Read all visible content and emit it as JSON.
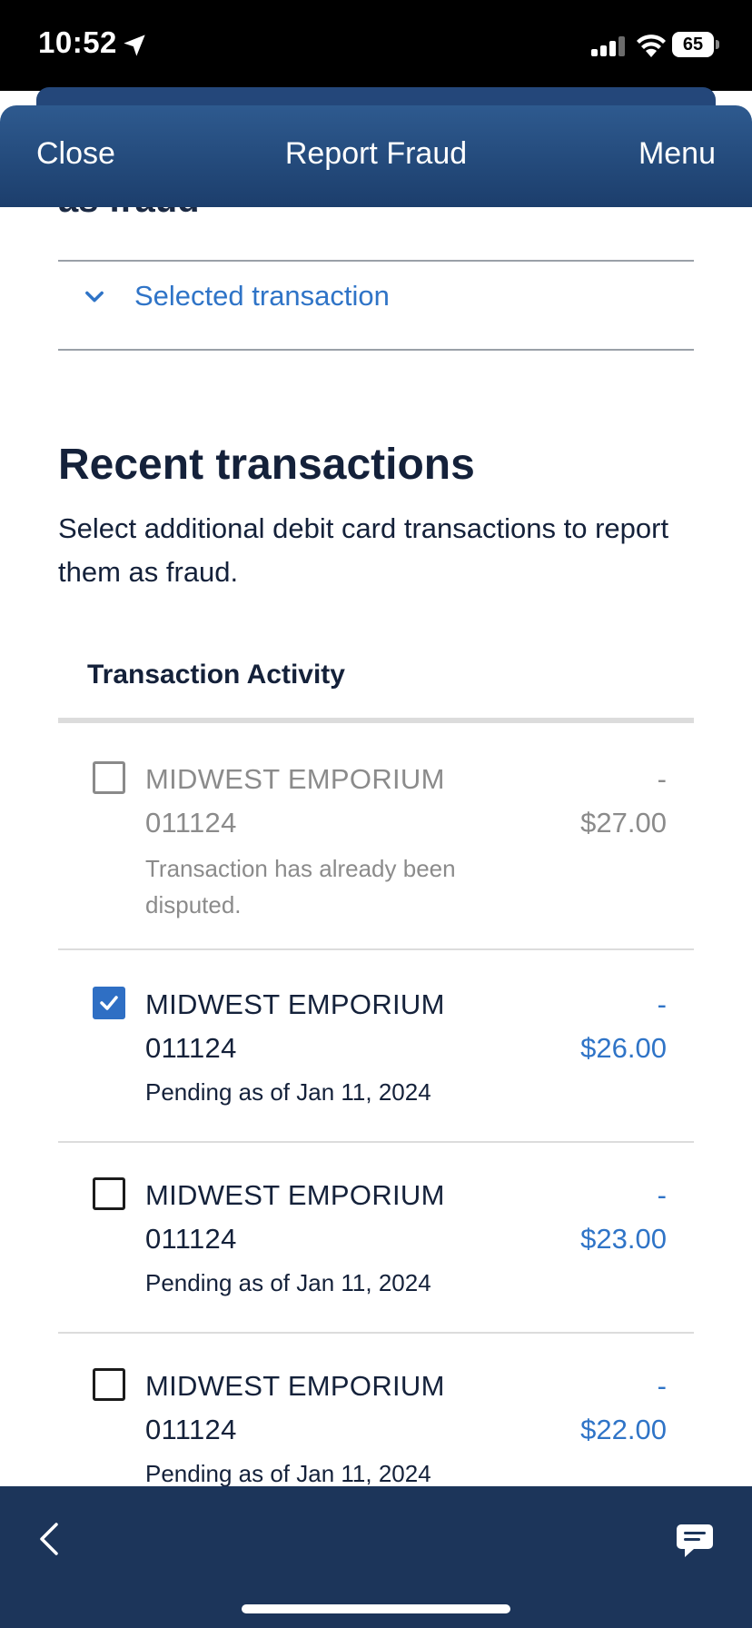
{
  "status_bar": {
    "time": "10:52",
    "battery": "65",
    "icons": [
      "location-arrow-icon",
      "cellular-signal-icon",
      "wifi-icon",
      "battery-icon"
    ]
  },
  "nav": {
    "close_label": "Close",
    "title": "Report Fraud",
    "menu_label": "Menu"
  },
  "top": {
    "cut_off_text": "as fraud",
    "selected_toggle_label": "Selected transaction"
  },
  "recent": {
    "title": "Recent transactions",
    "description": "Select additional debit card transactions to report them as fraud.",
    "activity_header": "Transaction Activity"
  },
  "transactions": [
    {
      "merchant": "MIDWEST EMPORIUM",
      "code": "011124",
      "note": "Transaction has already been disputed.",
      "sign": "-",
      "amount": "$27.00",
      "checked": false,
      "disabled": true
    },
    {
      "merchant": "MIDWEST EMPORIUM",
      "code": "011124",
      "note": "Pending as of Jan 11, 2024",
      "sign": "-",
      "amount": "$26.00",
      "checked": true,
      "disabled": false
    },
    {
      "merchant": "MIDWEST EMPORIUM",
      "code": "011124",
      "note": "Pending as of Jan 11, 2024",
      "sign": "-",
      "amount": "$23.00",
      "checked": false,
      "disabled": false
    },
    {
      "merchant": "MIDWEST EMPORIUM",
      "code": "011124",
      "note": "Pending as of Jan 11, 2024",
      "sign": "-",
      "amount": "$22.00",
      "checked": false,
      "disabled": false
    }
  ],
  "bottom_bar": {
    "icons": [
      "back-chevron-icon",
      "chat-icon"
    ]
  },
  "colors": {
    "nav_bg": "#2e5a8f",
    "bottom_bar_bg": "#1c355a",
    "accent_blue": "#2f74c7",
    "text_dark": "#14213a",
    "disabled_gray": "#8b8b8b"
  }
}
